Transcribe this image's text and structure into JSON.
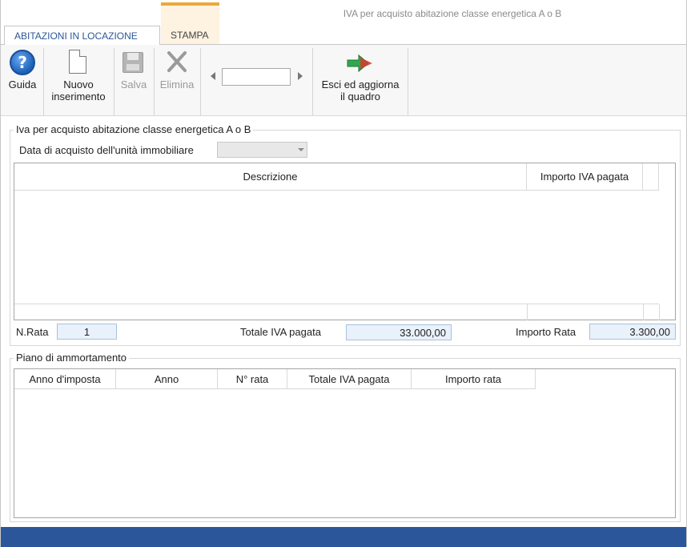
{
  "window": {
    "title": "IVA per acquisto abitazione classe energetica A o B"
  },
  "tabs": [
    {
      "label": "ABITAZIONI IN LOCAZIONE",
      "active": true
    },
    {
      "label": "STAMPA",
      "active": false
    }
  ],
  "toolbar": {
    "help_label": "Guida",
    "new_label_line1": "Nuovo",
    "new_label_line2": "inserimento",
    "save_label": "Salva",
    "delete_label": "Elimina",
    "record_value": "",
    "exit_label_line1": "Esci ed aggiorna",
    "exit_label_line2": "il quadro"
  },
  "section_iva": {
    "legend": "Iva per acquisto abitazione classe energetica A o B",
    "date_label": "Data di acquisto dell'unità immobiliare",
    "date_value": "",
    "grid_headers": [
      "Descrizione",
      "Importo IVA pagata"
    ],
    "n_rata_label": "N.Rata",
    "n_rata_value": "1",
    "totale_label": "Totale IVA pagata",
    "totale_value": "33.000,00",
    "importo_rata_label": "Importo Rata",
    "importo_rata_value": "3.300,00"
  },
  "section_piano": {
    "legend": "Piano di ammortamento",
    "grid_headers": [
      "Anno d'imposta",
      "Anno",
      "N° rata",
      "Totale IVA pagata",
      "Importo rata"
    ]
  },
  "colors": {
    "accent_tab": "#2b5797",
    "contextual_tab": "#e9a93a",
    "statusbar": "#2b579a",
    "value_box": "#e9f1fa"
  },
  "icons": {
    "help": "help-icon",
    "new": "new-document-icon",
    "save": "save-icon",
    "delete": "delete-icon",
    "prev": "chevron-left-icon",
    "next": "chevron-right-icon",
    "exit": "exit-arrow-icon",
    "dropdown": "chevron-down-icon"
  }
}
